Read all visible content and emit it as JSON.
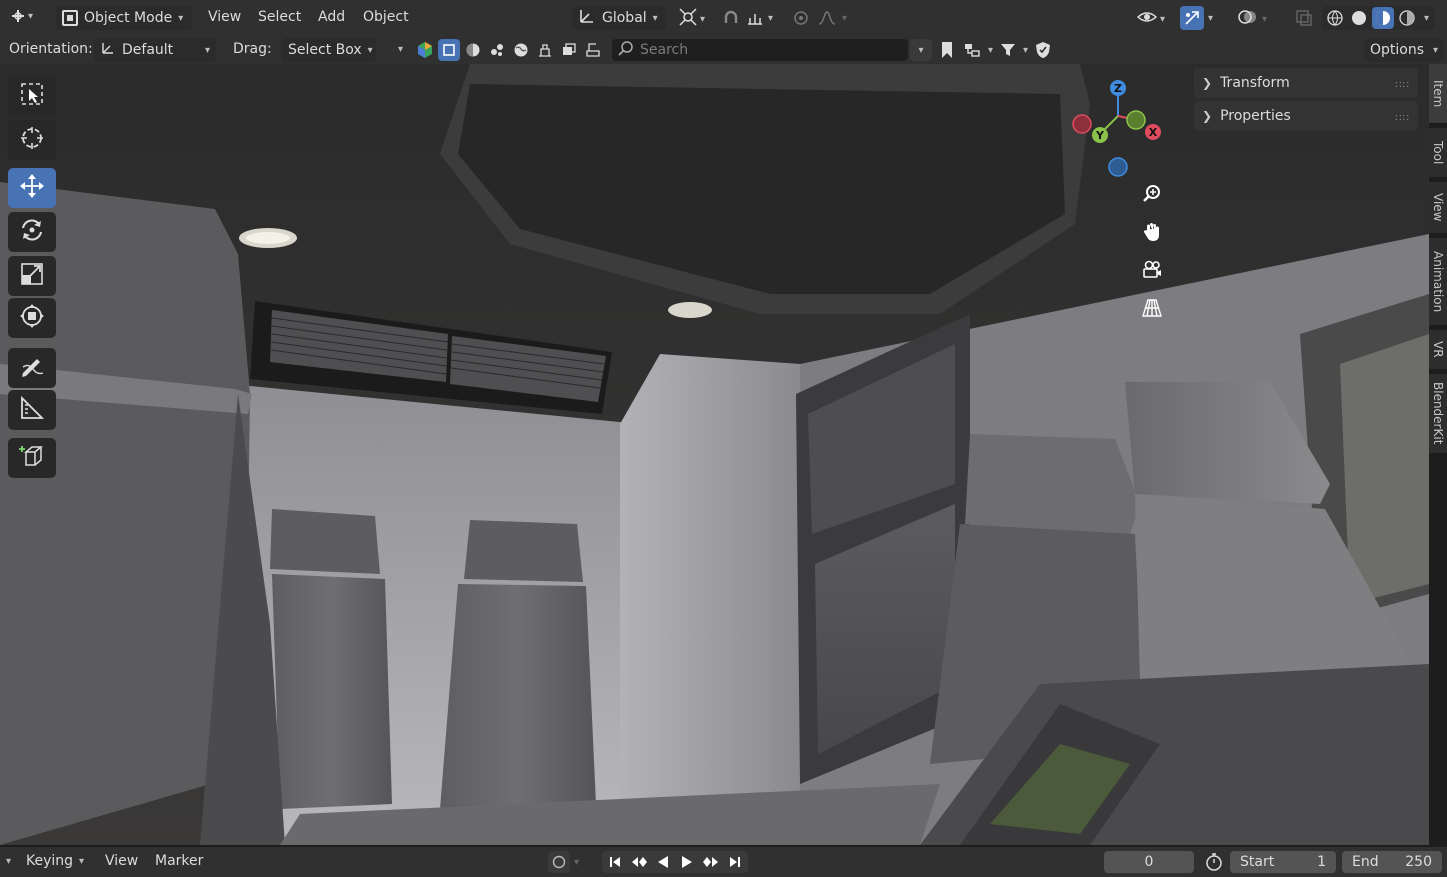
{
  "header": {
    "editor_type": "3D Viewport",
    "mode": "Object Mode",
    "menus": [
      "View",
      "Select",
      "Add",
      "Object"
    ],
    "transform_orientation": "Global"
  },
  "tool_settings": {
    "orientation_label": "Orientation:",
    "orientation_value": "Default",
    "drag_label": "Drag:",
    "drag_value": "Select Box",
    "search_placeholder": "Search",
    "options_label": "Options"
  },
  "toolbar": {
    "tools": [
      "Select Box",
      "Cursor",
      "Move",
      "Rotate",
      "Scale",
      "Transform",
      "Annotate",
      "Measure",
      "Add Cube"
    ],
    "active_tool": "Move"
  },
  "gizmo": {
    "axes": [
      "Z",
      "Y",
      "X"
    ]
  },
  "sidebar": {
    "panels": [
      {
        "label": "Transform"
      },
      {
        "label": "Properties"
      }
    ],
    "tabs": [
      "Item",
      "Tool",
      "View",
      "Animation",
      "VR",
      "BlenderKit"
    ],
    "active_tab": "Item"
  },
  "timeline": {
    "keying_label": "Keying",
    "view_label": "View",
    "marker_label": "Marker",
    "current_frame": "0",
    "start_label": "Start",
    "start_value": "1",
    "end_label": "End",
    "end_value": "250"
  },
  "colors": {
    "accent": "#4772b3",
    "header_bg": "#303030",
    "axis_x": "#e04b5e",
    "axis_y": "#8bc34a",
    "axis_z": "#3f8ce0"
  }
}
